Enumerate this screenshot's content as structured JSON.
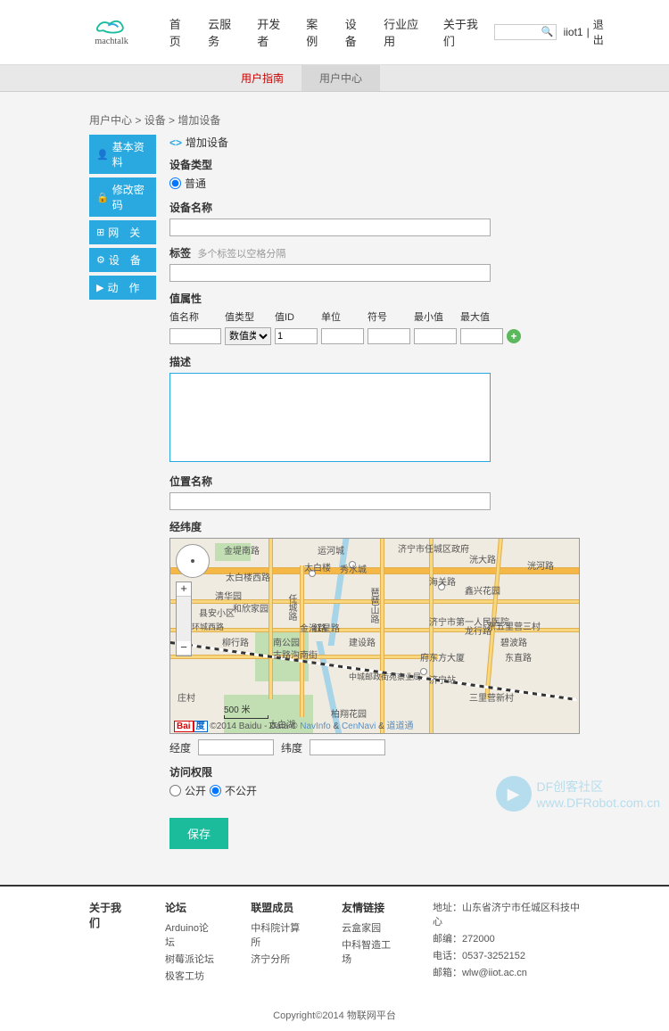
{
  "header": {
    "logo_text": "machtalk",
    "nav": [
      "首页",
      "云服务",
      "开发者",
      "案例",
      "设备",
      "行业应用",
      "关于我们"
    ],
    "user": "iiot1",
    "logout": "退出"
  },
  "subnav": {
    "guide": "用户指南",
    "center": "用户中心"
  },
  "breadcrumb": {
    "p1": "用户中心",
    "p2": "设备",
    "p3": "增加设备"
  },
  "sidebar": {
    "items": [
      "基本资料",
      "修改密码",
      "网　关",
      "设　备",
      "动　作"
    ]
  },
  "form": {
    "title": "增加设备",
    "type_label": "设备类型",
    "type_option": "普通",
    "name_label": "设备名称",
    "tag_label": "标签",
    "tag_hint": "多个标签以空格分隔",
    "attr_label": "值属性",
    "attr_headers": [
      "值名称",
      "值类型",
      "值ID",
      "单位",
      "符号",
      "最小值",
      "最大值"
    ],
    "attr_type_sel": "数值类",
    "attr_id_val": "1",
    "desc_label": "描述",
    "loc_label": "位置名称",
    "coord_label": "经纬度",
    "lng_label": "经度",
    "lat_label": "纬度",
    "access_label": "访问权限",
    "access_public": "公开",
    "access_private": "不公开",
    "save": "保存"
  },
  "map": {
    "scale": "500 米",
    "attrib_prefix": "©2014 Baidu - Data ©",
    "attrib_l1": "NavInfo",
    "attrib_amp": " & ",
    "attrib_l2": "CenNavi",
    "attrib_l3": "道道通",
    "labels": {
      "l1": "金堤南路",
      "l2": "运河城",
      "l3": "济宁市任城区政府",
      "l4": "洸大路",
      "l5": "洸河路",
      "l6": "太白楼西路",
      "l7": "太白楼",
      "l8": "秀水城",
      "l9": "海关路",
      "l10": "鑫兴花园",
      "l11": "清华园",
      "l12": "和欣家园",
      "l13": "任城路",
      "l14": "红星路",
      "l15": "济宁市第一人民医院",
      "l16": "东五里营三村",
      "l17": "县安小区",
      "l18": "金滑路",
      "l19": "环城西路",
      "l20": "柳行路",
      "l21": "南公园",
      "l22": "古路沟南街",
      "l23": "建设路",
      "l24": "琶琶山路",
      "l25": "龙行路",
      "l26": "碧波路",
      "l27": "府东方大厦",
      "l28": "东直路",
      "l29": "中城邮政街苑察业局",
      "l30": "济宁站",
      "l31": "三里营新村",
      "l32": "庄村",
      "l33": "柏翔花园",
      "l34": "太白湖"
    }
  },
  "footer": {
    "c1_h": "关于我们",
    "c2_h": "论坛",
    "c2_1": "Arduino论坛",
    "c2_2": "树莓派论坛",
    "c2_3": "极客工坊",
    "c3_h": "联盟成员",
    "c3_1": "中科院计算所",
    "c3_2": "济宁分所",
    "c4_h": "友情链接",
    "c4_1": "云盒家园",
    "c4_2": "中科智造工场",
    "addr": "地址：山东省济宁市任城区科技中心",
    "zip": "邮编：272000",
    "tel": "电话：0537-3252152",
    "email": "邮箱：wlw@iiot.ac.cn",
    "copyright": "Copyright©2014 物联网平台"
  },
  "watermark": {
    "t1": "DF创客社区",
    "t2": "www.DFRobot.com.cn"
  }
}
